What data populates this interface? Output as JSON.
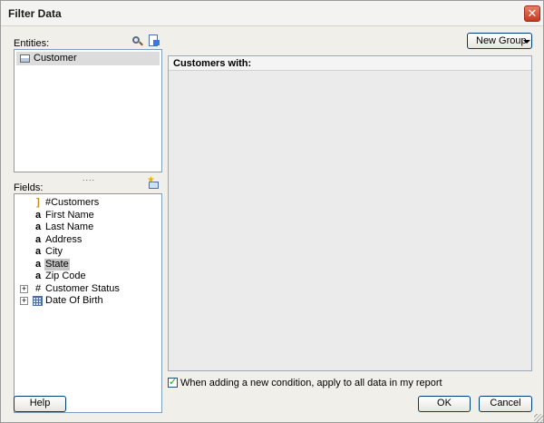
{
  "window": {
    "title": "Filter Data"
  },
  "entities": {
    "label": "Entities:",
    "items": [
      {
        "label": "Customer",
        "icon": "table-icon"
      }
    ]
  },
  "fields": {
    "label": "Fields:",
    "items": [
      {
        "label": "#Customers",
        "icon": "count-icon",
        "icon_text": "]",
        "expandable": false,
        "selected": false
      },
      {
        "label": "First Name",
        "icon": "text-field-icon",
        "icon_text": "a",
        "expandable": false,
        "selected": false
      },
      {
        "label": "Last Name",
        "icon": "text-field-icon",
        "icon_text": "a",
        "expandable": false,
        "selected": false
      },
      {
        "label": "Address",
        "icon": "text-field-icon",
        "icon_text": "a",
        "expandable": false,
        "selected": false
      },
      {
        "label": "City",
        "icon": "text-field-icon",
        "icon_text": "a",
        "expandable": false,
        "selected": false
      },
      {
        "label": "State",
        "icon": "text-field-icon",
        "icon_text": "a",
        "expandable": false,
        "selected": true
      },
      {
        "label": "Zip Code",
        "icon": "text-field-icon",
        "icon_text": "a",
        "expandable": false,
        "selected": false
      },
      {
        "label": "Customer Status",
        "icon": "number-field-icon",
        "icon_text": "#",
        "expandable": true,
        "selected": false
      },
      {
        "label": "Date Of Birth",
        "icon": "date-field-icon",
        "icon_text": "",
        "expandable": true,
        "selected": false
      }
    ],
    "expand_symbol": "+",
    "splitter": "...."
  },
  "main": {
    "header": "Customers with:"
  },
  "toolbar": {
    "new_group_label": "New Group"
  },
  "option": {
    "label": "When adding a new condition, apply to all data in my report",
    "checked": true,
    "check_glyph": "✓"
  },
  "buttons": {
    "help": "Help",
    "ok": "OK",
    "cancel": "Cancel",
    "close": "✕"
  },
  "colors": {
    "accent": "#003c74",
    "selected_row": "#c4c4c4",
    "panel_border": "#7f9db9",
    "close_red": "#c6391f"
  }
}
